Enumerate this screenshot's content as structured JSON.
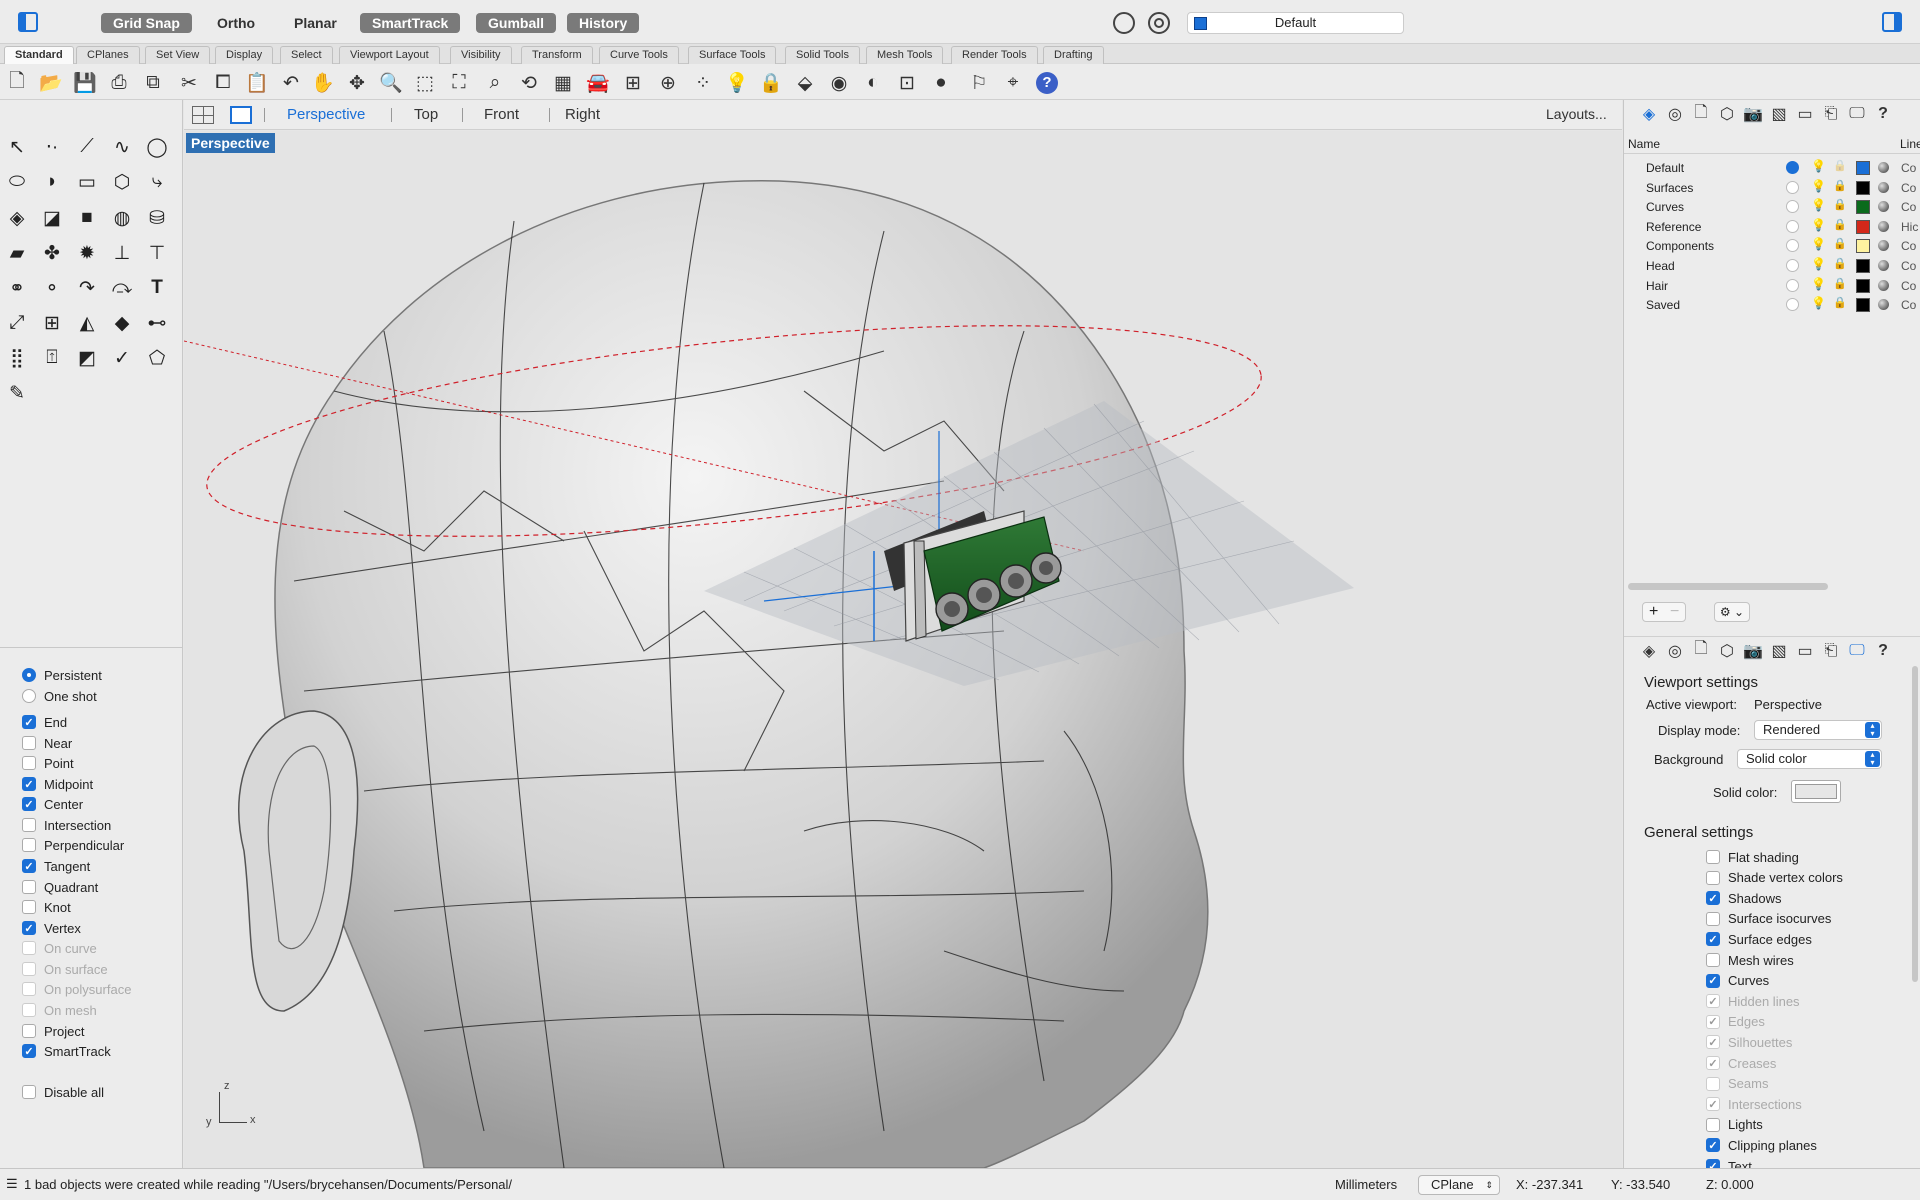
{
  "titlebar": {
    "modes": [
      {
        "label": "Grid Snap",
        "active": true
      },
      {
        "label": "Ortho",
        "active": false
      },
      {
        "label": "Planar",
        "active": false
      },
      {
        "label": "SmartTrack",
        "active": true
      },
      {
        "label": "Gumball",
        "active": true
      },
      {
        "label": "History",
        "active": true
      }
    ],
    "current_layer": "Default"
  },
  "tabs": [
    "Standard",
    "CPlanes",
    "Set View",
    "Display",
    "Select",
    "Viewport Layout",
    "Visibility",
    "Transform",
    "Curve Tools",
    "Surface Tools",
    "Solid Tools",
    "Mesh Tools",
    "Render Tools",
    "Drafting"
  ],
  "viewport_tabs": {
    "tabs": [
      "Perspective",
      "Top",
      "Front",
      "Right"
    ],
    "active": "Perspective",
    "layouts_button": "Layouts..."
  },
  "viewport": {
    "label": "Perspective"
  },
  "osnap": {
    "modes": [
      {
        "label": "Persistent",
        "selected": true
      },
      {
        "label": "One shot",
        "selected": false
      }
    ],
    "snaps": [
      {
        "label": "End",
        "checked": true,
        "enabled": true
      },
      {
        "label": "Near",
        "checked": false,
        "enabled": true
      },
      {
        "label": "Point",
        "checked": false,
        "enabled": true
      },
      {
        "label": "Midpoint",
        "checked": true,
        "enabled": true
      },
      {
        "label": "Center",
        "checked": true,
        "enabled": true
      },
      {
        "label": "Intersection",
        "checked": false,
        "enabled": true
      },
      {
        "label": "Perpendicular",
        "checked": false,
        "enabled": true
      },
      {
        "label": "Tangent",
        "checked": true,
        "enabled": true
      },
      {
        "label": "Quadrant",
        "checked": false,
        "enabled": true
      },
      {
        "label": "Knot",
        "checked": false,
        "enabled": true
      },
      {
        "label": "Vertex",
        "checked": true,
        "enabled": true
      },
      {
        "label": "On curve",
        "checked": false,
        "enabled": false
      },
      {
        "label": "On surface",
        "checked": false,
        "enabled": false
      },
      {
        "label": "On polysurface",
        "checked": false,
        "enabled": false
      },
      {
        "label": "On mesh",
        "checked": false,
        "enabled": false
      },
      {
        "label": "Project",
        "checked": false,
        "enabled": true
      },
      {
        "label": "SmartTrack",
        "checked": true,
        "enabled": true
      }
    ],
    "disable_all": {
      "label": "Disable all",
      "checked": false
    }
  },
  "layers": {
    "header_name": "Name",
    "header_line": "Line",
    "rows": [
      {
        "name": "Default",
        "current": true,
        "on": true,
        "locked": false,
        "color": "#1a6fd6",
        "linetype": "Co"
      },
      {
        "name": "Surfaces",
        "current": false,
        "on": true,
        "locked": true,
        "color": "#000000",
        "linetype": "Co"
      },
      {
        "name": "Curves",
        "current": false,
        "on": true,
        "locked": true,
        "color": "#0b6b1c",
        "linetype": "Co"
      },
      {
        "name": "Reference",
        "current": false,
        "on": true,
        "locked": true,
        "color": "#d3281a",
        "linetype": "Hic"
      },
      {
        "name": "Components",
        "current": false,
        "on": true,
        "locked": true,
        "color": "#fff3a0",
        "linetype": "Co"
      },
      {
        "name": "Head",
        "current": false,
        "on": true,
        "locked": true,
        "color": "#000000",
        "linetype": "Co"
      },
      {
        "name": "Hair",
        "current": false,
        "on": false,
        "locked": true,
        "color": "#000000",
        "linetype": "Co"
      },
      {
        "name": "Saved",
        "current": false,
        "on": false,
        "locked": true,
        "color": "#000000",
        "linetype": "Co"
      }
    ]
  },
  "viewport_settings": {
    "title": "Viewport settings",
    "active_viewport_label": "Active viewport:",
    "active_viewport": "Perspective",
    "display_mode_label": "Display mode:",
    "display_mode": "Rendered",
    "background_label": "Background",
    "background": "Solid color",
    "solid_color_label": "Solid color:"
  },
  "general_settings": {
    "title": "General settings",
    "items": [
      {
        "label": "Flat shading",
        "checked": false,
        "enabled": true
      },
      {
        "label": "Shade vertex colors",
        "checked": false,
        "enabled": true
      },
      {
        "label": "Shadows",
        "checked": true,
        "enabled": true
      },
      {
        "label": "Surface isocurves",
        "checked": false,
        "enabled": true
      },
      {
        "label": "Surface edges",
        "checked": true,
        "enabled": true
      },
      {
        "label": "Mesh wires",
        "checked": false,
        "enabled": true
      },
      {
        "label": "Curves",
        "checked": true,
        "enabled": true
      },
      {
        "label": "Hidden lines",
        "checked": true,
        "enabled": false
      },
      {
        "label": "Edges",
        "checked": true,
        "enabled": false
      },
      {
        "label": "Silhouettes",
        "checked": true,
        "enabled": false
      },
      {
        "label": "Creases",
        "checked": true,
        "enabled": false
      },
      {
        "label": "Seams",
        "checked": false,
        "enabled": false
      },
      {
        "label": "Intersections",
        "checked": true,
        "enabled": false
      },
      {
        "label": "Lights",
        "checked": false,
        "enabled": true
      },
      {
        "label": "Clipping planes",
        "checked": true,
        "enabled": true
      },
      {
        "label": "Text",
        "checked": true,
        "enabled": true
      }
    ]
  },
  "statusbar": {
    "message": "1 bad objects were created while reading \"/Users/brycehansen/Documents/Personal/",
    "units": "Millimeters",
    "cplane": "CPlane",
    "x": "X: -237.341",
    "y": "Y: -33.540",
    "z": "Z: 0.000"
  },
  "axis_labels": {
    "z": "z",
    "y": "y",
    "x": "x"
  },
  "colors": {
    "accent": "#1a6fd6",
    "viewport_label_bg": "#2e6fb2"
  }
}
